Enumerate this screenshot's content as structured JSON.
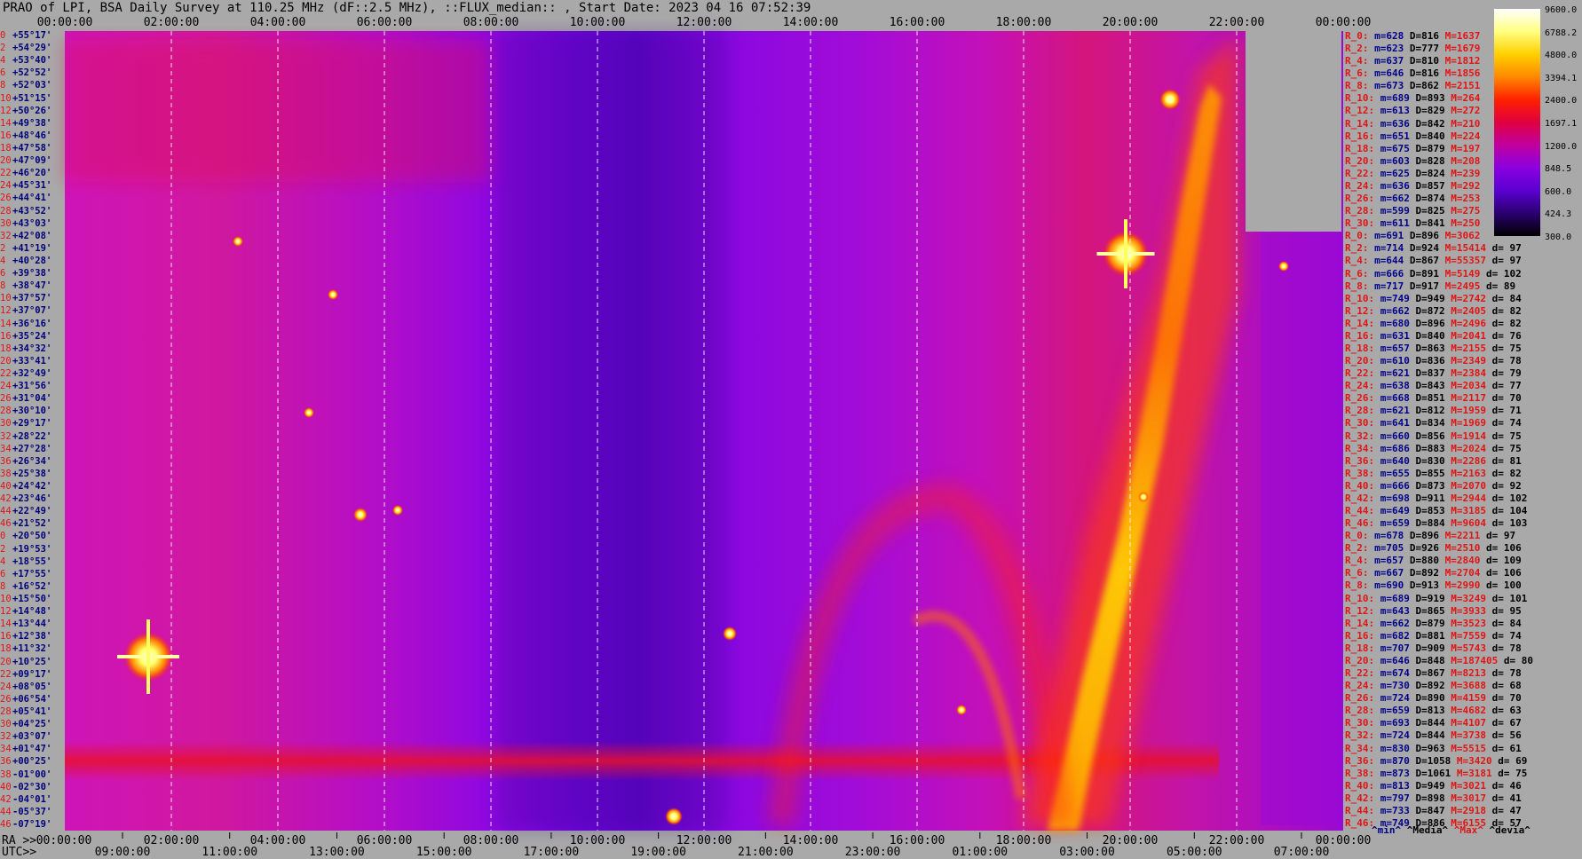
{
  "header": {
    "title": "PRAO of LPI, BSA Daily Survey at 110.25 MHz (dF::2.5 MHz), ::FLUX_median:: , Start Date: 2023 04 16 07:52:39"
  },
  "axes": {
    "ra_label": "RA >>",
    "utc_label": "UTC>>"
  },
  "chart_data": {
    "type": "heatmap",
    "title": "PRAO of LPI, BSA Daily Survey at 110.25 MHz (dF::2.5 MHz), ::FLUX_median:: , Start Date: 2023 04 16 07:52:39",
    "x_top_ticks": [
      "00:00:00",
      "02:00:00",
      "04:00:00",
      "06:00:00",
      "08:00:00",
      "10:00:00",
      "12:00:00",
      "14:00:00",
      "16:00:00",
      "18:00:00",
      "20:00:00",
      "22:00:00",
      "00:00:00"
    ],
    "x_ra_ticks": [
      "00:00:00",
      "02:00:00",
      "04:00:00",
      "06:00:00",
      "08:00:00",
      "10:00:00",
      "12:00:00",
      "14:00:00",
      "16:00:00",
      "18:00:00",
      "20:00:00",
      "22:00:00",
      "00:00:00"
    ],
    "x_utc_ticks": [
      "09:00:00",
      "11:00:00",
      "13:00:00",
      "15:00:00",
      "17:00:00",
      "19:00:00",
      "21:00:00",
      "23:00:00",
      "01:00:00",
      "03:00:00",
      "05:00:00",
      "07:00:00"
    ],
    "y_ticks": [
      {
        "i": "0",
        "dec": "+55°17'"
      },
      {
        "i": "2",
        "dec": "+54°29'"
      },
      {
        "i": "4",
        "dec": "+53°40'"
      },
      {
        "i": "6",
        "dec": "+52°52'"
      },
      {
        "i": "8",
        "dec": "+52°03'"
      },
      {
        "i": "10",
        "dec": "+51°15'"
      },
      {
        "i": "12",
        "dec": "+50°26'"
      },
      {
        "i": "14",
        "dec": "+49°38'"
      },
      {
        "i": "16",
        "dec": "+48°46'"
      },
      {
        "i": "18",
        "dec": "+47°58'"
      },
      {
        "i": "20",
        "dec": "+47°09'"
      },
      {
        "i": "22",
        "dec": "+46°20'"
      },
      {
        "i": "24",
        "dec": "+45°31'"
      },
      {
        "i": "26",
        "dec": "+44°41'"
      },
      {
        "i": "28",
        "dec": "+43°52'"
      },
      {
        "i": "30",
        "dec": "+43°03'"
      },
      {
        "i": "32",
        "dec": "+42°08'"
      },
      {
        "i": "2",
        "dec": "+41°19'"
      },
      {
        "i": "4",
        "dec": "+40°28'"
      },
      {
        "i": "6",
        "dec": "+39°38'"
      },
      {
        "i": "8",
        "dec": "+38°47'"
      },
      {
        "i": "10",
        "dec": "+37°57'"
      },
      {
        "i": "12",
        "dec": "+37°07'"
      },
      {
        "i": "14",
        "dec": "+36°16'"
      },
      {
        "i": "16",
        "dec": "+35°24'"
      },
      {
        "i": "18",
        "dec": "+34°32'"
      },
      {
        "i": "20",
        "dec": "+33°41'"
      },
      {
        "i": "22",
        "dec": "+32°49'"
      },
      {
        "i": "24",
        "dec": "+31°56'"
      },
      {
        "i": "26",
        "dec": "+31°04'"
      },
      {
        "i": "28",
        "dec": "+30°10'"
      },
      {
        "i": "30",
        "dec": "+29°17'"
      },
      {
        "i": "32",
        "dec": "+28°22'"
      },
      {
        "i": "34",
        "dec": "+27°28'"
      },
      {
        "i": "36",
        "dec": "+26°34'"
      },
      {
        "i": "38",
        "dec": "+25°38'"
      },
      {
        "i": "40",
        "dec": "+24°42'"
      },
      {
        "i": "42",
        "dec": "+23°46'"
      },
      {
        "i": "44",
        "dec": "+22°49'"
      },
      {
        "i": "46",
        "dec": "+21°52'"
      },
      {
        "i": "0",
        "dec": "+20°50'"
      },
      {
        "i": "2",
        "dec": "+19°53'"
      },
      {
        "i": "4",
        "dec": "+18°55'"
      },
      {
        "i": "6",
        "dec": "+17°55'"
      },
      {
        "i": "8",
        "dec": "+16°52'"
      },
      {
        "i": "10",
        "dec": "+15°50'"
      },
      {
        "i": "12",
        "dec": "+14°48'"
      },
      {
        "i": "14",
        "dec": "+13°44'"
      },
      {
        "i": "16",
        "dec": "+12°38'"
      },
      {
        "i": "18",
        "dec": "+11°32'"
      },
      {
        "i": "20",
        "dec": "+10°25'"
      },
      {
        "i": "22",
        "dec": "+09°17'"
      },
      {
        "i": "24",
        "dec": "+08°05'"
      },
      {
        "i": "26",
        "dec": "+06°54'"
      },
      {
        "i": "28",
        "dec": "+05°41'"
      },
      {
        "i": "30",
        "dec": "+04°25'"
      },
      {
        "i": "32",
        "dec": "+03°07'"
      },
      {
        "i": "34",
        "dec": "+01°47'"
      },
      {
        "i": "36",
        "dec": "+00°25'"
      },
      {
        "i": "38",
        "dec": "-01°00'"
      },
      {
        "i": "40",
        "dec": "-02°30'"
      },
      {
        "i": "42",
        "dec": "-04°01'"
      },
      {
        "i": "44",
        "dec": "-05°37'"
      },
      {
        "i": "46",
        "dec": "-07°19'"
      }
    ],
    "colorbar": {
      "labels": [
        "9600.0",
        "6788.2",
        "4800.0",
        "3394.1",
        "2400.0",
        "1697.1",
        "1200.0",
        "848.5",
        "600.0",
        "424.3",
        "300.0"
      ],
      "colors": [
        "#ffffff",
        "#ffff80",
        "#ffd000",
        "#ff8800",
        "#ff2000",
        "#e00040",
        "#c000a0",
        "#8a00e0",
        "#5a00d0",
        "#2a0070",
        "#000000"
      ]
    },
    "stats_legend": [
      "^min^",
      "^Media^",
      "^Max^",
      "^devia^"
    ],
    "stats": [
      {
        "r": "R_0:",
        "m": "m=628",
        "d": "D=816",
        "M": "M=1637",
        "dv": ""
      },
      {
        "r": "R_2:",
        "m": "m=623",
        "d": "D=777",
        "M": "M=1679",
        "dv": ""
      },
      {
        "r": "R_4:",
        "m": "m=637",
        "d": "D=810",
        "M": "M=1812",
        "dv": ""
      },
      {
        "r": "R_6:",
        "m": "m=646",
        "d": "D=816",
        "M": "M=1856",
        "dv": ""
      },
      {
        "r": "R_8:",
        "m": "m=673",
        "d": "D=862",
        "M": "M=2151",
        "dv": ""
      },
      {
        "r": "R_10:",
        "m": "m=689",
        "d": "D=893",
        "M": "M=264",
        "dv": ""
      },
      {
        "r": "R_12:",
        "m": "m=613",
        "d": "D=829",
        "M": "M=272",
        "dv": ""
      },
      {
        "r": "R_14:",
        "m": "m=636",
        "d": "D=842",
        "M": "M=210",
        "dv": ""
      },
      {
        "r": "R_16:",
        "m": "m=651",
        "d": "D=840",
        "M": "M=224",
        "dv": ""
      },
      {
        "r": "R_18:",
        "m": "m=675",
        "d": "D=879",
        "M": "M=197",
        "dv": ""
      },
      {
        "r": "R_20:",
        "m": "m=603",
        "d": "D=828",
        "M": "M=208",
        "dv": ""
      },
      {
        "r": "R_22:",
        "m": "m=625",
        "d": "D=824",
        "M": "M=239",
        "dv": ""
      },
      {
        "r": "R_24:",
        "m": "m=636",
        "d": "D=857",
        "M": "M=292",
        "dv": ""
      },
      {
        "r": "R_26:",
        "m": "m=662",
        "d": "D=874",
        "M": "M=253",
        "dv": ""
      },
      {
        "r": "R_28:",
        "m": "m=599",
        "d": "D=825",
        "M": "M=275",
        "dv": ""
      },
      {
        "r": "R_30:",
        "m": "m=611",
        "d": "D=841",
        "M": "M=250",
        "dv": ""
      },
      {
        "r": "R_0:",
        "m": "m=691",
        "d": "D=896",
        "M": "M=3062",
        "dv": ""
      },
      {
        "r": "R_2:",
        "m": "m=714",
        "d": "D=924",
        "M": "M=15414",
        "dv": "d= 97"
      },
      {
        "r": "R_4:",
        "m": "m=644",
        "d": "D=867",
        "M": "M=55357",
        "dv": "d= 97"
      },
      {
        "r": "R_6:",
        "m": "m=666",
        "d": "D=891",
        "M": "M=5149",
        "dv": "d= 102"
      },
      {
        "r": "R_8:",
        "m": "m=717",
        "d": "D=917",
        "M": "M=2495",
        "dv": "d= 89"
      },
      {
        "r": "R_10:",
        "m": "m=749",
        "d": "D=949",
        "M": "M=2742",
        "dv": "d= 84"
      },
      {
        "r": "R_12:",
        "m": "m=662",
        "d": "D=872",
        "M": "M=2405",
        "dv": "d= 82"
      },
      {
        "r": "R_14:",
        "m": "m=680",
        "d": "D=896",
        "M": "M=2496",
        "dv": "d= 82"
      },
      {
        "r": "R_16:",
        "m": "m=631",
        "d": "D=840",
        "M": "M=2041",
        "dv": "d= 76"
      },
      {
        "r": "R_18:",
        "m": "m=657",
        "d": "D=863",
        "M": "M=2155",
        "dv": "d= 75"
      },
      {
        "r": "R_20:",
        "m": "m=610",
        "d": "D=836",
        "M": "M=2349",
        "dv": "d= 78"
      },
      {
        "r": "R_22:",
        "m": "m=621",
        "d": "D=837",
        "M": "M=2384",
        "dv": "d= 79"
      },
      {
        "r": "R_24:",
        "m": "m=638",
        "d": "D=843",
        "M": "M=2034",
        "dv": "d= 77"
      },
      {
        "r": "R_26:",
        "m": "m=668",
        "d": "D=851",
        "M": "M=2117",
        "dv": "d= 70"
      },
      {
        "r": "R_28:",
        "m": "m=621",
        "d": "D=812",
        "M": "M=1959",
        "dv": "d= 71"
      },
      {
        "r": "R_30:",
        "m": "m=641",
        "d": "D=834",
        "M": "M=1969",
        "dv": "d= 74"
      },
      {
        "r": "R_32:",
        "m": "m=660",
        "d": "D=856",
        "M": "M=1914",
        "dv": "d= 75"
      },
      {
        "r": "R_34:",
        "m": "m=686",
        "d": "D=883",
        "M": "M=2024",
        "dv": "d= 75"
      },
      {
        "r": "R_36:",
        "m": "m=640",
        "d": "D=830",
        "M": "M=2286",
        "dv": "d= 81"
      },
      {
        "r": "R_38:",
        "m": "m=655",
        "d": "D=855",
        "M": "M=2163",
        "dv": "d= 82"
      },
      {
        "r": "R_40:",
        "m": "m=666",
        "d": "D=873",
        "M": "M=2070",
        "dv": "d= 92"
      },
      {
        "r": "R_42:",
        "m": "m=698",
        "d": "D=911",
        "M": "M=2944",
        "dv": "d= 102"
      },
      {
        "r": "R_44:",
        "m": "m=649",
        "d": "D=853",
        "M": "M=3185",
        "dv": "d= 104"
      },
      {
        "r": "R_46:",
        "m": "m=659",
        "d": "D=884",
        "M": "M=9604",
        "dv": "d= 103"
      },
      {
        "r": "R_0:",
        "m": "m=678",
        "d": "D=896",
        "M": "M=2211",
        "dv": "d= 97"
      },
      {
        "r": "R_2:",
        "m": "m=705",
        "d": "D=926",
        "M": "M=2510",
        "dv": "d= 106"
      },
      {
        "r": "R_4:",
        "m": "m=657",
        "d": "D=880",
        "M": "M=2840",
        "dv": "d= 109"
      },
      {
        "r": "R_6:",
        "m": "m=667",
        "d": "D=892",
        "M": "M=2704",
        "dv": "d= 106"
      },
      {
        "r": "R_8:",
        "m": "m=690",
        "d": "D=913",
        "M": "M=2990",
        "dv": "d= 100"
      },
      {
        "r": "R_10:",
        "m": "m=689",
        "d": "D=919",
        "M": "M=3249",
        "dv": "d= 101"
      },
      {
        "r": "R_12:",
        "m": "m=643",
        "d": "D=865",
        "M": "M=3933",
        "dv": "d= 95"
      },
      {
        "r": "R_14:",
        "m": "m=662",
        "d": "D=879",
        "M": "M=3523",
        "dv": "d= 84"
      },
      {
        "r": "R_16:",
        "m": "m=682",
        "d": "D=881",
        "M": "M=7559",
        "dv": "d= 74"
      },
      {
        "r": "R_18:",
        "m": "m=707",
        "d": "D=909",
        "M": "M=5743",
        "dv": "d= 78"
      },
      {
        "r": "R_20:",
        "m": "m=646",
        "d": "D=848",
        "M": "M=187405",
        "dv": "d= 80"
      },
      {
        "r": "R_22:",
        "m": "m=674",
        "d": "D=867",
        "M": "M=8213",
        "dv": "d= 78"
      },
      {
        "r": "R_24:",
        "m": "m=730",
        "d": "D=892",
        "M": "M=3688",
        "dv": "d= 68"
      },
      {
        "r": "R_26:",
        "m": "m=724",
        "d": "D=890",
        "M": "M=4159",
        "dv": "d= 70"
      },
      {
        "r": "R_28:",
        "m": "m=659",
        "d": "D=813",
        "M": "M=4682",
        "dv": "d= 63"
      },
      {
        "r": "R_30:",
        "m": "m=693",
        "d": "D=844",
        "M": "M=4107",
        "dv": "d= 67"
      },
      {
        "r": "R_32:",
        "m": "m=724",
        "d": "D=844",
        "M": "M=3738",
        "dv": "d= 56"
      },
      {
        "r": "R_34:",
        "m": "m=830",
        "d": "D=963",
        "M": "M=5515",
        "dv": "d= 61"
      },
      {
        "r": "R_36:",
        "m": "m=870",
        "d": "D=1058",
        "M": "M=3420",
        "dv": "d= 69"
      },
      {
        "r": "R_38:",
        "m": "m=873",
        "d": "D=1061",
        "M": "M=3181",
        "dv": "d= 75"
      },
      {
        "r": "R_40:",
        "m": "m=813",
        "d": "D=949",
        "M": "M=3021",
        "dv": "d= 46"
      },
      {
        "r": "R_42:",
        "m": "m=797",
        "d": "D=898",
        "M": "M=3017",
        "dv": "d= 41"
      },
      {
        "r": "R_44:",
        "m": "m=733",
        "d": "D=847",
        "M": "M=2918",
        "dv": "d= 47"
      },
      {
        "r": "R_46:",
        "m": "m=749",
        "d": "D=886",
        "M": "M=6155",
        "dv": "d= 57"
      }
    ]
  }
}
